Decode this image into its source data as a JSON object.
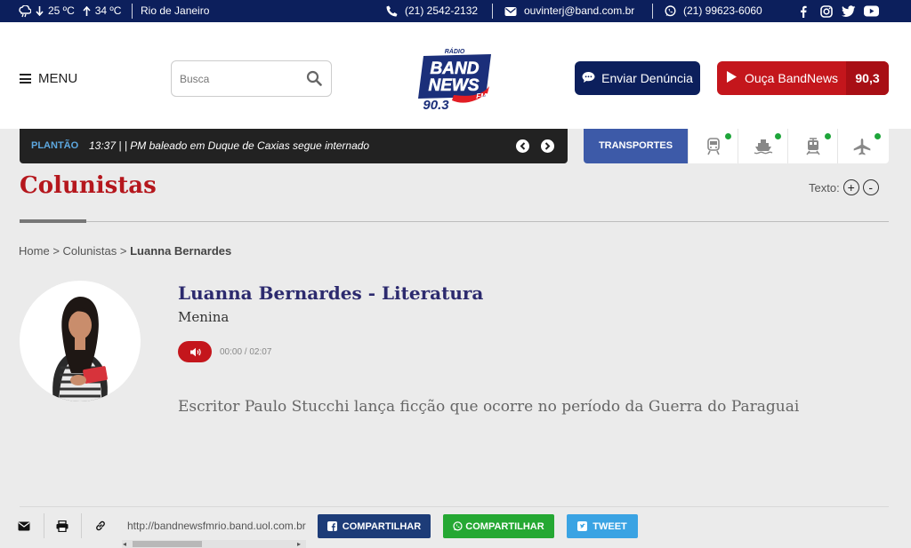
{
  "topbar": {
    "temp_min": "25 ºC",
    "temp_max": "34 ºC",
    "city": "Rio de Janeiro",
    "phone": "(21) 2542-2132",
    "email": "ouvinterj@band.com.br",
    "whatsapp": "(21) 99623-6060",
    "social_icons": [
      "facebook-icon",
      "instagram-icon",
      "twitter-icon",
      "youtube-icon"
    ]
  },
  "header": {
    "menu_label": "MENU",
    "search_placeholder": "Busca",
    "logo": {
      "top": "RÁDIO",
      "line1": "BAND",
      "line2": "NEWS",
      "fm": "FM",
      "freq": "90.3"
    },
    "denuncia_label": "Enviar Denúncia",
    "ouca_label": "Ouça BandNews",
    "ouca_freq": "90,3"
  },
  "plantao": {
    "tag": "PLANTÃO",
    "text": "13:37 | | PM baleado em Duque de Caxias segue internado"
  },
  "transportes": {
    "label": "TRANSPORTES",
    "items": [
      "train-icon",
      "ferry-icon",
      "metro-icon",
      "airplane-icon"
    ],
    "status_color": "#1ea53a"
  },
  "page": {
    "title": "Colunistas",
    "text_size_label": "Texto:",
    "plus": "+",
    "minus": "-"
  },
  "breadcrumb": {
    "home": "Home",
    "sep": ">",
    "section": "Colunistas",
    "current": "Luanna Bernardes"
  },
  "author": {
    "name": "Luanna Bernardes - Literatura",
    "subtitle": "Menina",
    "audio_time": "00:00 / 02:07",
    "headline": "Escritor Paulo Stucchi lança ficção que ocorre no período da Guerra do Paraguai"
  },
  "share": {
    "url": "http://bandnewsfmrio.band.uol.com.br",
    "facebook_label": "COMPARTILHAR",
    "whatsapp_label": "COMPARTILHAR",
    "tweet_label": "TWEET"
  },
  "colors": {
    "navy": "#0c1f5c",
    "red": "#c4161c",
    "transport_blue": "#3d5aa8",
    "facebook": "#1d3c78",
    "whatsapp": "#25a833",
    "twitter": "#3aa3e3"
  }
}
